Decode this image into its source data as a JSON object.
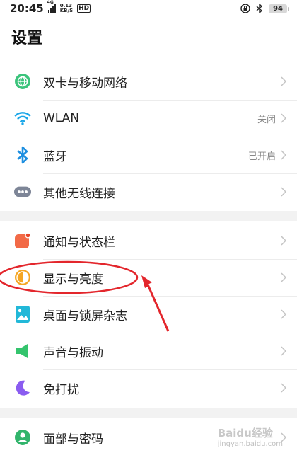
{
  "status_bar": {
    "time": "20:45",
    "signal_label": "4G",
    "net_speed_value": "0.13",
    "net_speed_unit": "KB/S",
    "hd_label": "HD",
    "battery": "94"
  },
  "page": {
    "title": "设置"
  },
  "groups": [
    {
      "items": [
        {
          "label": "双卡与移动网络",
          "value": "",
          "icon": "globe-icon",
          "icon_color": "#3cc47c"
        },
        {
          "label": "WLAN",
          "value": "关闭",
          "icon": "wifi-icon",
          "icon_color": "#1aa6e8"
        },
        {
          "label": "蓝牙",
          "value": "已开启",
          "icon": "bluetooth-icon",
          "icon_color": "#1e8fe0"
        },
        {
          "label": "其他无线连接",
          "value": "",
          "icon": "more-icon",
          "icon_color": "#7d8597"
        }
      ]
    },
    {
      "items": [
        {
          "label": "通知与状态栏",
          "value": "",
          "icon": "notification-icon",
          "icon_color": "#f26a47"
        },
        {
          "label": "显示与亮度",
          "value": "",
          "icon": "brightness-icon",
          "icon_color": "#f5a623"
        },
        {
          "label": "桌面与锁屏杂志",
          "value": "",
          "icon": "wallpaper-icon",
          "icon_color": "#22b8d8"
        },
        {
          "label": "声音与振动",
          "value": "",
          "icon": "speaker-icon",
          "icon_color": "#34c46d"
        },
        {
          "label": "免打扰",
          "value": "",
          "icon": "moon-icon",
          "icon_color": "#8a5cf0"
        }
      ]
    },
    {
      "items": [
        {
          "label": "面部与密码",
          "value": "",
          "icon": "face-password-icon",
          "icon_color": "#31b46b"
        }
      ]
    }
  ],
  "watermark": {
    "title": "Baidu经验",
    "url": "jingyan.baidu.com"
  }
}
